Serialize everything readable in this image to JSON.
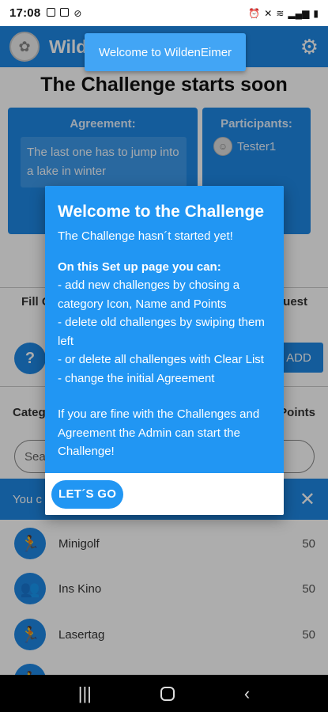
{
  "status_bar": {
    "time": "17:08",
    "left_icons": [
      "calendar-icon",
      "image-icon",
      "mute-icon"
    ],
    "right_icons": [
      "alarm-icon",
      "vibrate-icon",
      "wifi-icon",
      "signal-icon",
      "battery-icon"
    ]
  },
  "app_bar": {
    "title": "WildenEimer",
    "title_visible": "Wild"
  },
  "snackbar_top": {
    "text": "Welcome to WildenEimer"
  },
  "page_heading": "The Challenge starts soon",
  "agreement_card": {
    "title": "Agreement:",
    "text": "The last one has to jump into a lake in winter"
  },
  "participants_card": {
    "title": "Participants:",
    "participants": [
      {
        "name": "Tester1"
      }
    ]
  },
  "fill_row": {
    "left": "Fill C",
    "right": "uest"
  },
  "add_button": "ADD",
  "columns": {
    "category": "Categ",
    "points": "Points"
  },
  "search": {
    "placeholder": "Sea"
  },
  "snackbar_bottom": {
    "text": "You c"
  },
  "challenges": [
    {
      "name": "Minigolf",
      "points": "50",
      "icon": "run-icon"
    },
    {
      "name": "Ins Kino",
      "points": "50",
      "icon": "group-icon"
    },
    {
      "name": "Lasertag",
      "points": "50",
      "icon": "run-icon"
    }
  ],
  "dialog": {
    "title": "Welcome to the Challenge",
    "subtitle": "The Challenge hasn´t started yet!",
    "setup_heading": "On this Set up page you can:",
    "lines": [
      "- add new challenges by chosing a",
      "category Icon, Name and Points",
      "- delete old challenges by swiping them",
      "left",
      "- or delete all challenges with Clear List",
      "- change the initial Agreement"
    ],
    "closing_lines": [
      "If you are fine with the Challenges and",
      "Agreement the Admin can start the",
      "Challenge!"
    ],
    "button": "LET´S GO"
  },
  "colors": {
    "primary": "#1e88e5",
    "dialog": "#2196f3",
    "snackbar": "#42a5f5"
  }
}
